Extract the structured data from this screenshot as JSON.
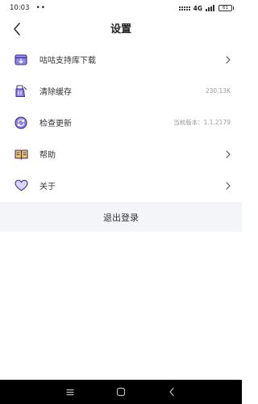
{
  "status_bar": {
    "time": "10:03",
    "dots": "••",
    "network": "4G",
    "battery": "61"
  },
  "header": {
    "title": "设置",
    "back_icon": "back-chevron-icon"
  },
  "settings": [
    {
      "label": "咕咕支持库下载",
      "value": "",
      "icon": "download-box-icon",
      "has_chevron": true
    },
    {
      "label": "清除缓存",
      "value": "230.13K",
      "icon": "clear-cache-icon",
      "has_chevron": false
    },
    {
      "label": "检查更新",
      "value": "当前版本：1.1.2179",
      "icon": "update-icon",
      "has_chevron": false
    },
    {
      "label": "帮助",
      "value": "",
      "icon": "book-icon",
      "has_chevron": true
    },
    {
      "label": "关于",
      "value": "",
      "icon": "heart-icon",
      "has_chevron": true
    }
  ],
  "logout": {
    "label": "退出登录"
  },
  "system_nav": {
    "icons": [
      "menu-icon",
      "home-icon",
      "back-icon"
    ]
  },
  "colors": {
    "accent": "#5b4fc4",
    "accent_light": "#8e85e6",
    "icon_yellow": "#f4c84a",
    "panel_bg": "#f4f5f9",
    "value_gray": "#999999"
  }
}
